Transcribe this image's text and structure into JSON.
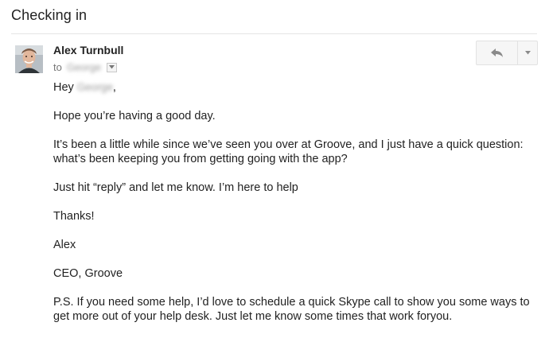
{
  "email": {
    "subject": "Checking in",
    "sender_name": "Alex Turnbull",
    "to_label": "to",
    "recipient_name": "George",
    "greeting_prefix": "Hey",
    "greeting_name": "George",
    "greeting_suffix": ",",
    "paragraphs": [
      "Hope you’re having a good day.",
      "It’s been a little while since we’ve seen you over at Groove, and I just have a quick question: what’s been keeping you from getting going with the app?",
      "Just hit “reply” and let me know. I’m here to help",
      "Thanks!",
      "Alex",
      "CEO, Groove",
      "P.S. If you need some help, I’d love to schedule a quick Skype call to show you some ways to get more out of your help desk. Just let me know some times that work foryou."
    ]
  },
  "actions": {
    "reply_icon": "reply-arrow-icon",
    "more_icon": "chevron-down-icon"
  },
  "colors": {
    "text": "#222222",
    "muted": "#777777",
    "divider": "#e5e5e5",
    "button_bg": "#f6f6f6"
  }
}
